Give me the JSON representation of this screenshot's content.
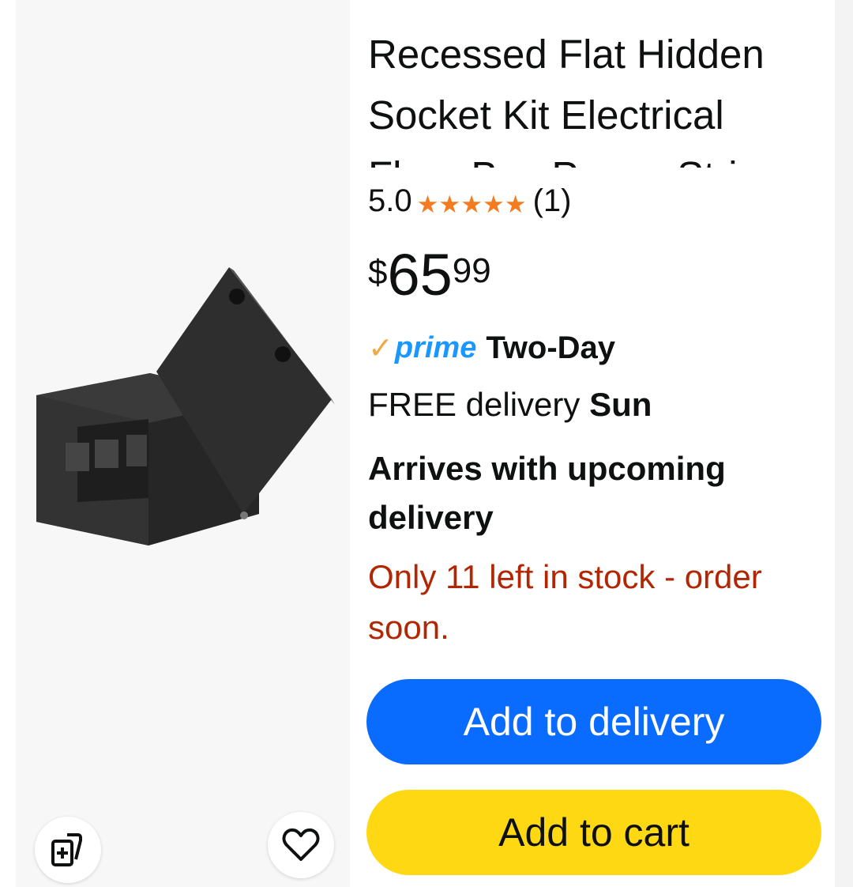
{
  "product": {
    "title": "Recessed Flat Hidden Socket Kit Electrical Floor Box Power Strip",
    "rating": "5.0",
    "rating_count": "(1)",
    "price_symbol": "$",
    "price_whole": "65",
    "price_fraction": "99"
  },
  "delivery": {
    "prime_check": "✓",
    "prime_label": "prime",
    "speed": "Two-Day",
    "free_text": "FREE delivery ",
    "day": "Sun",
    "arrives": "Arrives with upcoming delivery",
    "stock": "Only 11 left in stock - order soon."
  },
  "actions": {
    "add_to_delivery": "Add to delivery",
    "add_to_cart": "Add to cart"
  },
  "icons": [
    "compare-icon",
    "heart-icon",
    "star-icon"
  ],
  "colors": {
    "star": "#f47b1f",
    "prime_blue": "#1a98ff",
    "prime_check": "#f3a847",
    "stock_red": "#b12704",
    "delivery_button": "#0a6cff",
    "cart_button": "#ffd814"
  }
}
